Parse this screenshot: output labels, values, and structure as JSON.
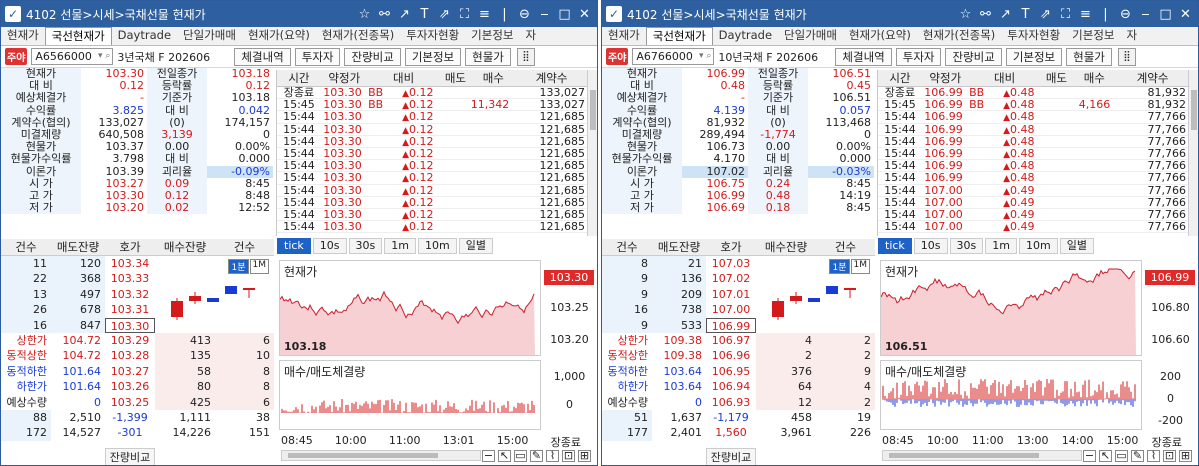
{
  "windows": [
    {
      "title": "4102 선물>시세>국채선물 현재가",
      "tabs": [
        "현재가",
        "국선현재가",
        "Daytrade",
        "단일가매매",
        "현재가(요약)",
        "현재가(전종목)",
        "투자자현황",
        "기본정보",
        "자"
      ],
      "active_tab": 1,
      "badge": "주야",
      "code": "A6566000",
      "instrument": "3년국채 F 202606",
      "buttons": [
        "체결내역",
        "투자자",
        "잔량비교",
        "기본정보",
        "현물가"
      ],
      "info": [
        [
          "현재가",
          "103.30",
          "전일종가",
          "103.18"
        ],
        [
          "대 비",
          "0.12",
          "등락률",
          "0.12"
        ],
        [
          "예상체결가",
          "-",
          "기준가",
          "103.18"
        ],
        [
          "수익률",
          "3.825",
          "대 비",
          "0.042"
        ],
        [
          "계약수(협의)",
          "133,027",
          "(0)",
          "174,157"
        ],
        [
          "미결제량",
          "640,508",
          "3,139",
          "0"
        ],
        [
          "현물가",
          "103.37",
          "0.00",
          "0.00%"
        ],
        [
          "현물가수익률",
          "3.798",
          "대 비",
          "0.000"
        ],
        [
          "이론가",
          "103.39",
          "괴리율",
          "-0.09%"
        ],
        [
          "시 가",
          "103.27",
          "0.09",
          "8:45"
        ],
        [
          "고 가",
          "103.30",
          "0.12",
          "8:48"
        ],
        [
          "저 가",
          "103.20",
          "0.02",
          "12:52"
        ]
      ],
      "trade_headers": [
        "시간",
        "약정가",
        "대비",
        "매도",
        "매수",
        "계약수"
      ],
      "trades": [
        [
          "장종료",
          "103.30",
          "BB",
          "0.12",
          "",
          "",
          "133,027"
        ],
        [
          "15:45",
          "103.30",
          "BB",
          "0.12",
          "",
          "11,342",
          "133,027"
        ],
        [
          "15:44",
          "103.30",
          "",
          "0.12",
          "",
          "",
          "121,685"
        ],
        [
          "15:44",
          "103.30",
          "",
          "0.12",
          "",
          "",
          "121,685"
        ],
        [
          "15:44",
          "103.30",
          "",
          "0.12",
          "",
          "",
          "121,685"
        ],
        [
          "15:44",
          "103.30",
          "",
          "0.12",
          "",
          "",
          "121,685"
        ],
        [
          "15:44",
          "103.30",
          "",
          "0.12",
          "",
          "",
          "121,685"
        ],
        [
          "15:44",
          "103.30",
          "",
          "0.12",
          "",
          "",
          "121,685"
        ],
        [
          "15:44",
          "103.30",
          "",
          "0.12",
          "",
          "",
          "121,685"
        ],
        [
          "15:44",
          "103.30",
          "",
          "0.12",
          "",
          "",
          "121,685"
        ],
        [
          "15:44",
          "103.30",
          "",
          "0.12",
          "",
          "",
          "121,685"
        ],
        [
          "15:44",
          "103.30",
          "",
          "0.12",
          "",
          "",
          "121,685"
        ]
      ],
      "book_headers": [
        "건수",
        "매도잔량",
        "호가",
        "매수잔량",
        "건수"
      ],
      "asks": [
        [
          "11",
          "120",
          "103.34"
        ],
        [
          "22",
          "368",
          "103.33"
        ],
        [
          "13",
          "497",
          "103.32"
        ],
        [
          "26",
          "678",
          "103.31"
        ],
        [
          "16",
          "847",
          "103.30"
        ]
      ],
      "bids": [
        [
          "상한가",
          "104.72",
          "103.29",
          "413",
          "6"
        ],
        [
          "동적상한",
          "104.72",
          "103.28",
          "135",
          "10"
        ],
        [
          "동적하한",
          "101.64",
          "103.27",
          "58",
          "8"
        ],
        [
          "하한가",
          "101.64",
          "103.26",
          "80",
          "8"
        ],
        [
          "예상수량",
          "0",
          "103.25",
          "425",
          "6"
        ]
      ],
      "book_totals": [
        [
          "88",
          "2,510",
          "-1,399",
          "1,111",
          "38"
        ],
        [
          "172",
          "14,527",
          "-301",
          "14,226",
          "151"
        ]
      ],
      "book_footer": "잔량비교",
      "chart_tabs": [
        "tick",
        "10s",
        "30s",
        "1m",
        "10m",
        "일별"
      ],
      "price_label": "현재가",
      "price_tag": "103.30",
      "price_axis": [
        "103.25",
        "103.20"
      ],
      "min_label": "103.18",
      "vol_label": "매수/매도체결량",
      "vol_axis": [
        "1,000",
        "0"
      ],
      "time_axis": [
        "08:45",
        "10:00",
        "11:00",
        "13:01",
        "15:00",
        "장종료"
      ],
      "seg": [
        "1분",
        "1M"
      ]
    },
    {
      "title": "4102 선물>시세>국채선물 현재가",
      "tabs": [
        "현재가",
        "국선현재가",
        "Daytrade",
        "단일가매매",
        "현재가(요약)",
        "현재가(전종목)",
        "투자자현황",
        "기본정보",
        "자"
      ],
      "active_tab": 1,
      "badge": "주야",
      "code": "A6766000",
      "instrument": "10년국채 F 202606",
      "buttons": [
        "체결내역",
        "투자자",
        "잔량비교",
        "기본정보",
        "현물가"
      ],
      "info": [
        [
          "현재가",
          "106.99",
          "전일종가",
          "106.51"
        ],
        [
          "대 비",
          "0.48",
          "등락률",
          "0.45"
        ],
        [
          "예상체결가",
          "-",
          "기준가",
          "106.51"
        ],
        [
          "수익률",
          "4.139",
          "대 비",
          "0.057"
        ],
        [
          "계약수(협의)",
          "81,932",
          "(0)",
          "113,468"
        ],
        [
          "미결제량",
          "289,494",
          "-1,774",
          "0"
        ],
        [
          "현물가",
          "106.73",
          "0.00",
          "0.00%"
        ],
        [
          "현물가수익률",
          "4.170",
          "대 비",
          "0.000"
        ],
        [
          "이론가",
          "107.02",
          "괴리율",
          "-0.03%"
        ],
        [
          "시 가",
          "106.75",
          "0.24",
          "8:45"
        ],
        [
          "고 가",
          "106.99",
          "0.48",
          "14:19"
        ],
        [
          "저 가",
          "106.69",
          "0.18",
          "8:45"
        ]
      ],
      "trade_headers": [
        "시간",
        "약정가",
        "대비",
        "매도",
        "매수",
        "계약수"
      ],
      "trades": [
        [
          "장종료",
          "106.99",
          "BB",
          "0.48",
          "",
          "",
          "81,932"
        ],
        [
          "15:45",
          "106.99",
          "BB",
          "0.48",
          "",
          "4,166",
          "81,932"
        ],
        [
          "15:44",
          "106.99",
          "",
          "0.48",
          "",
          "",
          "77,766"
        ],
        [
          "15:44",
          "106.99",
          "",
          "0.48",
          "",
          "",
          "77,766"
        ],
        [
          "15:44",
          "106.99",
          "",
          "0.48",
          "",
          "",
          "77,766"
        ],
        [
          "15:44",
          "106.99",
          "",
          "0.48",
          "",
          "",
          "77,766"
        ],
        [
          "15:44",
          "106.99",
          "",
          "0.48",
          "",
          "",
          "77,766"
        ],
        [
          "15:44",
          "106.99",
          "",
          "0.48",
          "",
          "",
          "77,766"
        ],
        [
          "15:44",
          "107.00",
          "",
          "0.49",
          "",
          "",
          "77,766"
        ],
        [
          "15:44",
          "107.00",
          "",
          "0.49",
          "",
          "",
          "77,766"
        ],
        [
          "15:44",
          "107.00",
          "",
          "0.49",
          "",
          "",
          "77,766"
        ],
        [
          "15:44",
          "107.00",
          "",
          "0.49",
          "",
          "",
          "77,766"
        ]
      ],
      "book_headers": [
        "건수",
        "매도잔량",
        "호가",
        "매수잔량",
        "건수"
      ],
      "asks": [
        [
          "8",
          "21",
          "107.03"
        ],
        [
          "9",
          "136",
          "107.02"
        ],
        [
          "9",
          "209",
          "107.01"
        ],
        [
          "16",
          "738",
          "107.00"
        ],
        [
          "9",
          "533",
          "106.99"
        ]
      ],
      "bids": [
        [
          "상한가",
          "109.38",
          "106.97",
          "4",
          "2"
        ],
        [
          "동적상한",
          "109.38",
          "106.96",
          "2",
          "2"
        ],
        [
          "동적하한",
          "103.64",
          "106.95",
          "376",
          "9"
        ],
        [
          "하한가",
          "103.64",
          "106.94",
          "64",
          "4"
        ],
        [
          "예상수량",
          "0",
          "106.93",
          "12",
          "2"
        ]
      ],
      "book_totals": [
        [
          "51",
          "1,637",
          "-1,179",
          "458",
          "19"
        ],
        [
          "177",
          "2,401",
          "1,560",
          "3,961",
          "226"
        ]
      ],
      "book_footer": "잔량비교",
      "chart_tabs": [
        "tick",
        "10s",
        "30s",
        "1m",
        "10m",
        "일별"
      ],
      "price_label": "현재가",
      "price_tag": "106.99",
      "price_axis": [
        "106.80",
        "106.60"
      ],
      "min_label": "106.51",
      "vol_label": "매수/매도체결량",
      "vol_axis": [
        "200",
        "0",
        "-200"
      ],
      "time_axis": [
        "08:45",
        "10:00",
        "11:00",
        "13:00",
        "14:00",
        "15:00",
        "장종료"
      ],
      "seg": [
        "1분",
        "1M"
      ]
    }
  ],
  "colors": {
    "titlebar": "#2e5f9f",
    "up": "#d41a1a",
    "down": "#1a3ad4",
    "accent": "#1f62c6"
  }
}
